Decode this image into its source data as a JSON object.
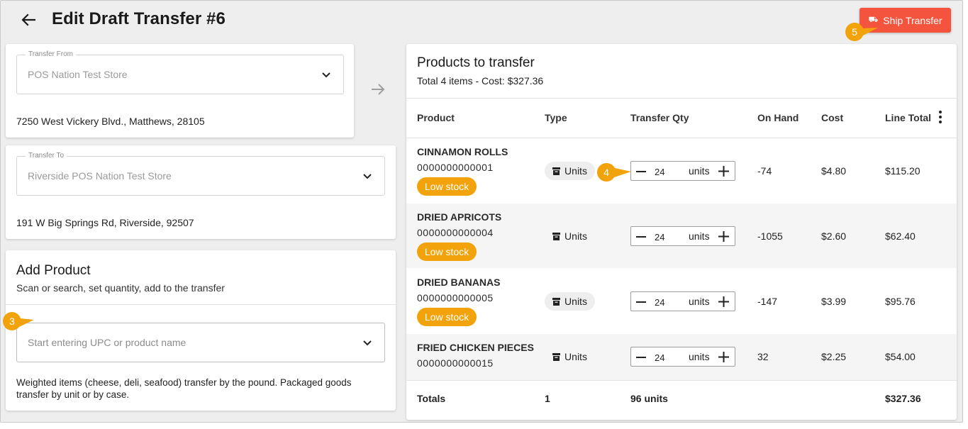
{
  "header": {
    "title": "Edit Draft Transfer #6",
    "ship_button": "Ship Transfer",
    "accent": "#f4533d"
  },
  "markers": [
    "3",
    "4",
    "5"
  ],
  "transfer_from": {
    "label": "Transfer From",
    "value": "POS Nation Test Store",
    "address": "7250 West Vickery Blvd., Matthews, 28105"
  },
  "transfer_to": {
    "label": "Transfer To",
    "value": "Riverside POS Nation Test Store",
    "address": "191 W Big Springs Rd, Riverside, 92507"
  },
  "add_product": {
    "title": "Add Product",
    "subtitle": "Scan or search, set quantity, add to the transfer",
    "placeholder": "Start entering UPC or product name",
    "note": "Weighted items (cheese, deli, seafood) transfer by the pound. Packaged goods transfer by unit or by case."
  },
  "products": {
    "title": "Products to transfer",
    "summary": "Total 4 items - Cost: $327.36",
    "columns": [
      "Product",
      "Type",
      "Transfer Qty",
      "On Hand",
      "Cost",
      "Line Total"
    ],
    "rows": [
      {
        "name": "CINNAMON ROLLS",
        "upc": "0000000000001",
        "badge": "Low stock",
        "type": "Units",
        "qty": "24",
        "unit": "units",
        "on_hand": "-74",
        "cost": "$4.80",
        "line_total": "$115.20"
      },
      {
        "name": "DRIED APRICOTS",
        "upc": "0000000000004",
        "badge": "Low stock",
        "type": "Units",
        "qty": "24",
        "unit": "units",
        "on_hand": "-1055",
        "cost": "$2.60",
        "line_total": "$62.40"
      },
      {
        "name": "DRIED BANANAS",
        "upc": "0000000000005",
        "badge": "Low stock",
        "type": "Units",
        "qty": "24",
        "unit": "units",
        "on_hand": "-147",
        "cost": "$3.99",
        "line_total": "$95.76"
      },
      {
        "name": "FRIED CHICKEN PIECES",
        "upc": "0000000000015",
        "badge": "",
        "type": "Units",
        "qty": "24",
        "unit": "units",
        "on_hand": "32",
        "cost": "$2.25",
        "line_total": "$54.00"
      }
    ],
    "totals": {
      "label": "Totals",
      "types": "1",
      "qty": "96 units",
      "line_total": "$327.36"
    }
  }
}
